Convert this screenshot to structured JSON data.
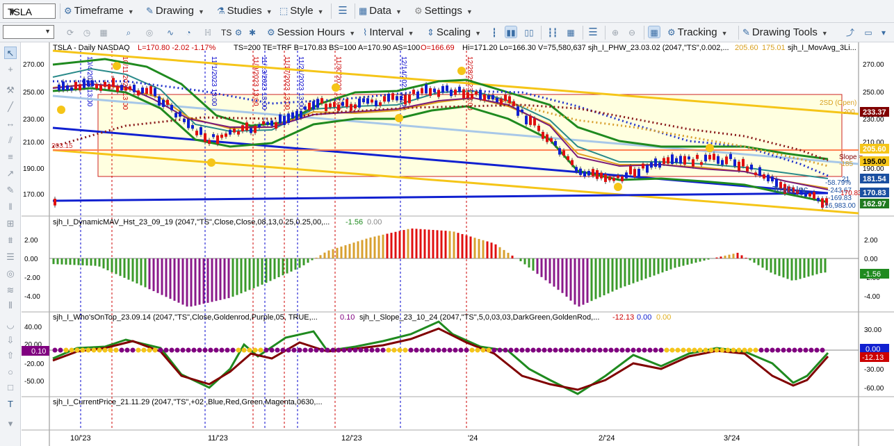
{
  "toolbar": {
    "symbol": "TSLA",
    "timeframe": "Timeframe",
    "drawing": "Drawing",
    "studies": "Studies",
    "style": "Style",
    "data": "Data",
    "settings": "Settings",
    "session_hours": "Session Hours",
    "interval": "Interval",
    "scaling": "Scaling",
    "tracking": "Tracking",
    "drawing_tools": "Drawing Tools"
  },
  "header": {
    "title": "TSLA - Daily  NASDAQ",
    "l_change": "L=170.80  -2.02  -1.17%",
    "stats": "TS=200  TE=TRF  B=170.83  BS=100  A=170.90  AS=100",
    "open": "O=166.69",
    "hilo": "Hi=171.20  Lo=166.30  V=75,580,637  sjh_I_PHW_23.03.02 (2047,\"TS\",0.002,...",
    "val1": "205.60",
    "val2": "175.01",
    "tail": "sjh_I_MovAvg_3Li..."
  },
  "chart_annotations": {
    "sd_label": "2SD (Open)",
    "sd_value": "200",
    "slope_label": "Slope =",
    "left_level": "203.15",
    "pct": "-58.79%",
    "v1": "-243.67",
    "v2": "170.83",
    "v3": "-169.83",
    "v4": "-16,983.00",
    "v5": "21",
    "tesla_label": "Tesla Inc",
    "sd_right": "-185"
  },
  "price_badges": [
    {
      "text": "233.37",
      "bg": "#800000",
      "fg": "#ffffff"
    },
    {
      "text": "205.60",
      "bg": "#f5c518",
      "fg": "#ffffff"
    },
    {
      "text": "195.00",
      "bg": "#f5c518",
      "fg": "#000000"
    },
    {
      "text": "181.54",
      "bg": "#1a4fa0",
      "fg": "#ffffff"
    },
    {
      "text": "170.83",
      "bg": "#1a4fa0",
      "fg": "#ffffff"
    },
    {
      "text": "162.97",
      "bg": "#1f7a1f",
      "fg": "#ffffff"
    }
  ],
  "date_stamps": [
    {
      "text": "10/4/2023 13:00",
      "color": "#0000cc"
    },
    {
      "text": "10/11/2023 13:00",
      "color": "#cc0000"
    },
    {
      "text": "11/1/2023 13:00",
      "color": "#0000cc"
    },
    {
      "text": "11/9/2023 13:00",
      "color": "#cc0000"
    },
    {
      "text": "11/13/2023 13:00",
      "color": "#0000cc"
    },
    {
      "text": "11/17/2023 13:00",
      "color": "#cc0000"
    },
    {
      "text": "11/21/2023 13:00",
      "color": "#0000cc"
    },
    {
      "text": "11/30/2023 13:00",
      "color": "#cc0000"
    },
    {
      "text": "12/14/2023 13:00",
      "color": "#0000cc"
    },
    {
      "text": "12/28/2023 13:00",
      "color": "#cc0000"
    }
  ],
  "price_axis": [
    "270.00",
    "250.00",
    "230.00",
    "210.00",
    "190.00",
    "170.00"
  ],
  "panel2": {
    "title": "sjh_I_DynamicMAV_Hst_23_09_19 (2047,\"TS\",Close,Close,08,13,0.25,0.25,00,...",
    "v1": "-1.56",
    "v2": "0.00",
    "axis": [
      "2.00",
      "0.00",
      "-2.00",
      "-4.00"
    ],
    "badge": "-1.56"
  },
  "panel3": {
    "title": "sjh_I_Who'sOnTop_23.09.14 (2047,\"TS\",Close,Goldenrod,Purple,05,  TRUE,...",
    "v1": "0.10",
    "title2": "sjh_I_Slope_23_10_24 (2047,\"TS\",5,0,03,03,DarkGreen,GoldenRod,...",
    "v2": "-12.13",
    "v3": "0.00",
    "v4": "0.00",
    "axis": [
      "30.00",
      "0.00",
      "-30.00",
      "-60.00"
    ],
    "left_axis": [
      "40.00",
      "20.00",
      "10.00",
      "-20.00",
      "-50.00"
    ],
    "left_badge": "0.10",
    "badge1": "0.00",
    "badge2": "-12.13"
  },
  "panel4": {
    "title": "sjh_I_CurrentPrice_21.11.29 (2047,\"TS\",+02 ,Blue,Red,Green,Magenta,0630,..."
  },
  "date_axis": [
    "10/'23",
    "11/'23",
    "12/'23",
    "'24",
    "2/'24",
    "3/'24"
  ],
  "colors": {
    "ma_green": "#1f8a1f",
    "ma_teal": "#2a8a8a",
    "ma_gold": "#e0a020",
    "ma_purple": "#7a1a7a",
    "trend_blue": "#1020d0",
    "channel_yellow": "#f5c518",
    "light_blue": "#a8c8e8",
    "hist_green": "#3a9a2a",
    "hist_purple": "#8a1a8a",
    "hist_red": "#e01010",
    "hist_gold": "#d8a030"
  }
}
